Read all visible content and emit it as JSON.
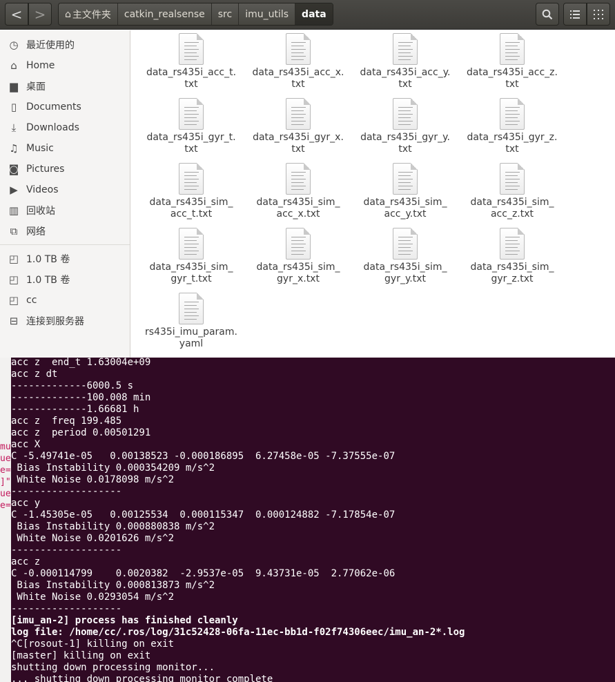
{
  "terminal": {
    "edge_lines": [
      "",
      "",
      "",
      "",
      "",
      "",
      "",
      "mu",
      "ue",
      "e=",
      "]\"",
      "ue",
      "e=",
      "",
      "",
      "",
      "",
      "",
      "",
      "",
      "",
      "",
      "",
      "",
      "",
      "",
      "",
      ""
    ],
    "lines": [
      {
        "text": "acc z  end_t 1.63004e+09",
        "bold": false
      },
      {
        "text": "acc z dt",
        "bold": false
      },
      {
        "text": "-------------6000.5 s",
        "bold": false
      },
      {
        "text": "-------------100.008 min",
        "bold": false
      },
      {
        "text": "-------------1.66681 h",
        "bold": false
      },
      {
        "text": "acc z  freq 199.485",
        "bold": false
      },
      {
        "text": "acc z  period 0.00501291",
        "bold": false
      },
      {
        "text": "acc X",
        "bold": false
      },
      {
        "text": "C -5.49741e-05   0.00138523 -0.000186895  6.27458e-05 -7.37555e-07",
        "bold": false
      },
      {
        "text": " Bias Instability 0.000354209 m/s^2",
        "bold": false
      },
      {
        "text": " White Noise 0.0178098 m/s^2",
        "bold": false
      },
      {
        "text": "-------------------",
        "bold": false
      },
      {
        "text": "acc y",
        "bold": false
      },
      {
        "text": "C -1.45305e-05   0.00125534  0.000115347  0.000124882 -7.17854e-07",
        "bold": false
      },
      {
        "text": " Bias Instability 0.000880838 m/s^2",
        "bold": false
      },
      {
        "text": " White Noise 0.0201626 m/s^2",
        "bold": false
      },
      {
        "text": "-------------------",
        "bold": false
      },
      {
        "text": "acc z",
        "bold": false
      },
      {
        "text": "C -0.000114799    0.0020382  -2.9537e-05  9.43731e-05  2.77062e-06",
        "bold": false
      },
      {
        "text": " Bias Instability 0.000813873 m/s^2",
        "bold": false
      },
      {
        "text": " White Noise 0.0293054 m/s^2",
        "bold": false
      },
      {
        "text": "-------------------",
        "bold": false
      },
      {
        "text": "[imu_an-2] process has finished cleanly",
        "bold": true
      },
      {
        "text": "log file: /home/cc/.ros/log/31c52428-06fa-11ec-bb1d-f02f74306eec/imu_an-2*.log",
        "bold": true
      },
      {
        "text": "^C[rosout-1] killing on exit",
        "bold": false
      },
      {
        "text": "[master] killing on exit",
        "bold": false
      },
      {
        "text": "shutting down processing monitor...",
        "bold": false
      },
      {
        "text": "... shutting down processing monitor complete",
        "bold": false
      }
    ]
  },
  "file_manager": {
    "nav": {
      "back": "<",
      "forward": ">"
    },
    "path": [
      {
        "label": "主文件夹",
        "home": true
      },
      {
        "label": "catkin_realsense"
      },
      {
        "label": "src"
      },
      {
        "label": "imu_utils"
      },
      {
        "label": "data",
        "active": true
      }
    ],
    "sidebar": {
      "places": [
        {
          "label": "最近使用的",
          "icon": "clock-icon",
          "glyph": "◷"
        },
        {
          "label": "Home",
          "icon": "home-icon",
          "glyph": "⌂"
        },
        {
          "label": "桌面",
          "icon": "folder-icon",
          "glyph": "▆"
        },
        {
          "label": "Documents",
          "icon": "document-icon",
          "glyph": "▯"
        },
        {
          "label": "Downloads",
          "icon": "download-icon",
          "glyph": "⤓"
        },
        {
          "label": "Music",
          "icon": "music-icon",
          "glyph": "♫"
        },
        {
          "label": "Pictures",
          "icon": "camera-icon",
          "glyph": "◙"
        },
        {
          "label": "Videos",
          "icon": "video-icon",
          "glyph": "▶"
        },
        {
          "label": "回收站",
          "icon": "trash-icon",
          "glyph": "▥"
        },
        {
          "label": "网络",
          "icon": "network-icon",
          "glyph": "⧉"
        }
      ],
      "devices": [
        {
          "label": "1.0 TB 卷",
          "icon": "drive-icon",
          "glyph": "◰"
        },
        {
          "label": "1.0 TB 卷",
          "icon": "drive-icon",
          "glyph": "◰"
        },
        {
          "label": "cc",
          "icon": "drive-icon",
          "glyph": "◰"
        },
        {
          "label": "连接到服务器",
          "icon": "server-icon",
          "glyph": "⊟"
        }
      ]
    },
    "files": [
      "data_rs435i_acc_t.\ntxt",
      "data_rs435i_acc_x.\ntxt",
      "data_rs435i_acc_y.\ntxt",
      "data_rs435i_acc_z.\ntxt",
      "data_rs435i_gyr_t.\ntxt",
      "data_rs435i_gyr_x.\ntxt",
      "data_rs435i_gyr_y.\ntxt",
      "data_rs435i_gyr_z.\ntxt",
      "data_rs435i_sim_\nacc_t.txt",
      "data_rs435i_sim_\nacc_x.txt",
      "data_rs435i_sim_\nacc_y.txt",
      "data_rs435i_sim_\nacc_z.txt",
      "data_rs435i_sim_\ngyr_t.txt",
      "data_rs435i_sim_\ngyr_x.txt",
      "data_rs435i_sim_\ngyr_y.txt",
      "data_rs435i_sim_\ngyr_z.txt",
      "rs435i_imu_param.\nyaml"
    ]
  }
}
